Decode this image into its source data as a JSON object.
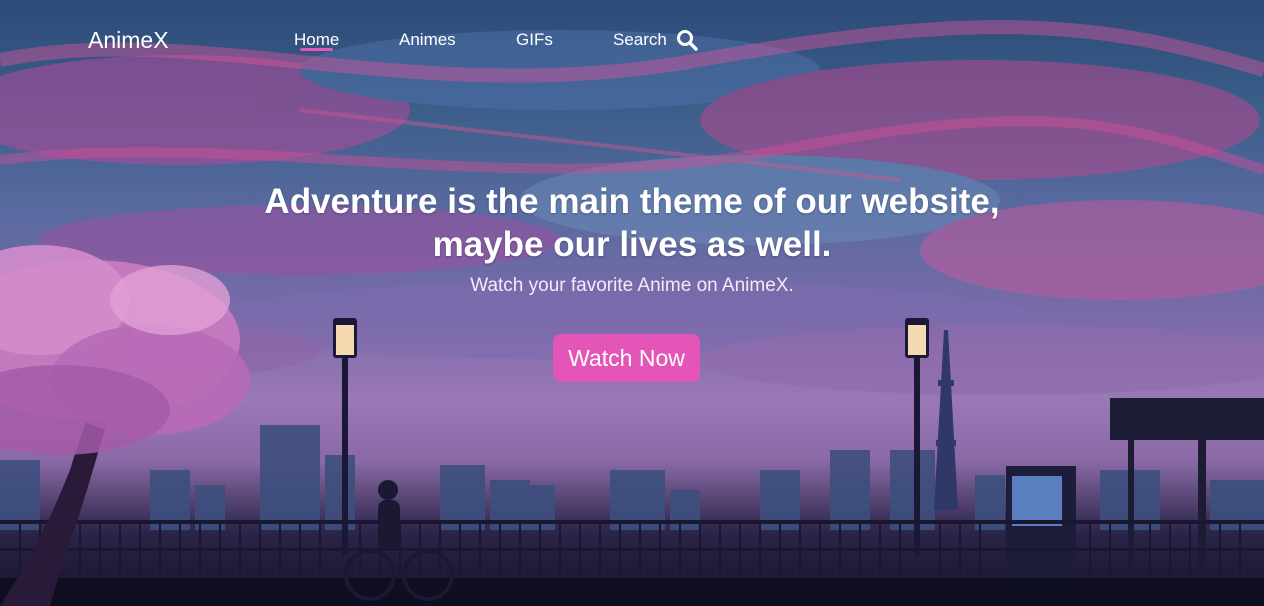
{
  "nav": {
    "logo": "AnimeX",
    "items": [
      {
        "label": "Home",
        "active": true
      },
      {
        "label": "Animes",
        "active": false
      },
      {
        "label": "GIFs",
        "active": false
      },
      {
        "label": "Search",
        "active": false
      }
    ],
    "search_icon": "search-icon"
  },
  "hero": {
    "headline_line1": "Adventure is the main theme of our website,",
    "headline_line2": "maybe our lives as well.",
    "subheadline": "Watch your favorite Anime on AnimeX.",
    "cta_label": "Watch Now"
  },
  "colors": {
    "accent": "#e356b8",
    "text": "#ffffff"
  }
}
